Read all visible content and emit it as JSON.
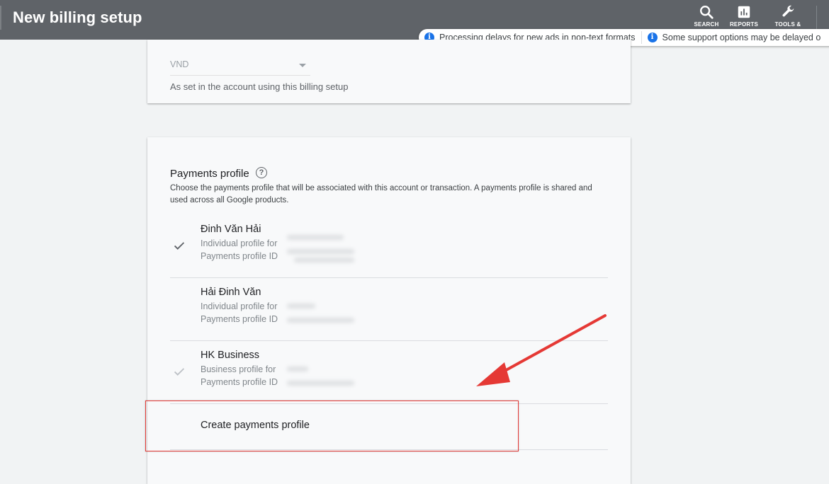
{
  "header": {
    "title": "New billing setup",
    "actions": [
      {
        "label": "SEARCH",
        "icon": "search-icon"
      },
      {
        "label": "REPORTS",
        "icon": "reports-icon"
      },
      {
        "label": "TOOLS &",
        "icon": "wrench-icon"
      }
    ]
  },
  "notifications": [
    "Processing delays for new ads in non-text formats",
    "Some support options may be delayed o"
  ],
  "currency": {
    "value": "VND",
    "help": "As set in the account using this billing setup"
  },
  "payments_profile": {
    "title": "Payments profile",
    "description": "Choose the payments profile that will be associated with this account or transaction. A payments profile is shared and used across all Google products.",
    "profiles": [
      {
        "name": "Đinh Văn Hải",
        "type": "Individual profile for",
        "id_label": "Payments profile ID",
        "selected": true
      },
      {
        "name": "Hải Đinh Văn",
        "type": "Individual profile for",
        "id_label": "Payments profile ID",
        "selected": false
      },
      {
        "name": "HK Business",
        "type": "Business profile for",
        "id_label": "Payments profile ID",
        "selected": false
      }
    ],
    "create_label": "Create payments profile"
  },
  "colors": {
    "header_bg": "#5f6368",
    "info_blue": "#1a73e8",
    "annotation_red": "#e53935"
  }
}
